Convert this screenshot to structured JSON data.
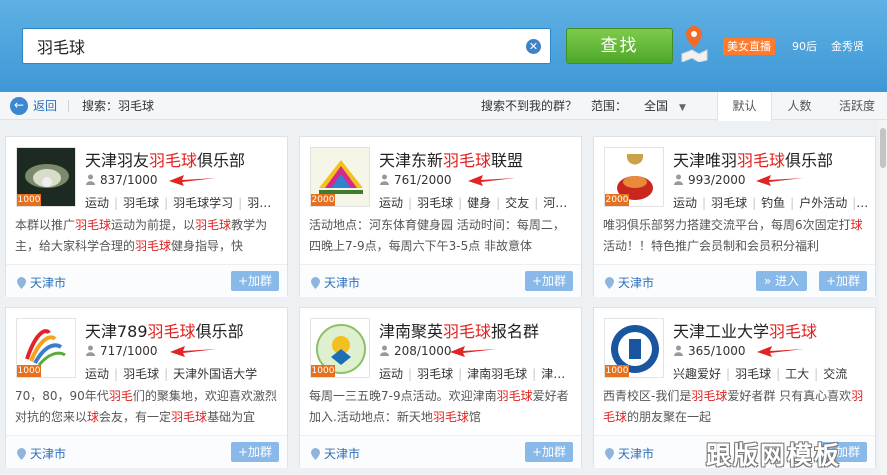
{
  "search": {
    "value": "羽毛球",
    "button_label": "查找"
  },
  "header_links": {
    "live": "美女直播",
    "post90": "90后",
    "beauty": "金秀贤"
  },
  "subbar": {
    "back_label": "返回",
    "search_label": "搜索：羽毛球",
    "not_found": "搜索不到我的群？",
    "range_label": "范围：",
    "range_value": "全国",
    "sort_tabs": [
      "默认",
      "人数",
      "活跃度"
    ]
  },
  "card_actions": {
    "add": "+加群",
    "enter": "» 进入"
  },
  "cards": [
    {
      "title_pre": "天津羽友",
      "title_hl": "羽毛球",
      "title_post": "俱乐部",
      "members": "837/1000",
      "level": "1000",
      "tags": [
        "运动",
        "羽毛球",
        "羽毛球学习",
        "羽…"
      ],
      "desc": [
        {
          "t": "本群以推广"
        },
        {
          "h": "羽毛球"
        },
        {
          "t": "运动为前提，以"
        },
        {
          "h": "羽毛球"
        },
        {
          "t": "教学为主，给大家科学合理的"
        },
        {
          "h": "羽毛球"
        },
        {
          "t": "健身指导，快"
        }
      ],
      "location": "天津市"
    },
    {
      "title_pre": "天津东新",
      "title_hl": "羽毛球",
      "title_post": "联盟",
      "members": "761/2000",
      "level": "2000",
      "tags": [
        "运动",
        "羽毛球",
        "健身",
        "交友",
        "河…"
      ],
      "desc": [
        {
          "t": "活动地点：河东体育健身园 活动时间：每周二，四晚上7-9点，每周六下午3-5点 非故意体"
        }
      ],
      "location": "天津市"
    },
    {
      "title_pre": "天津唯羽",
      "title_hl": "羽毛球",
      "title_post": "俱乐部",
      "members": "993/2000",
      "level": "2000",
      "tags": [
        "运动",
        "羽毛球",
        "钓鱼",
        "户外活动",
        "…"
      ],
      "desc": [
        {
          "t": "唯羽俱乐部努力搭建交流平台，每周6次固定打"
        },
        {
          "h": "球"
        },
        {
          "t": "活动！！特色推广会员制和会员积分福利"
        }
      ],
      "location": "天津市"
    },
    {
      "title_pre": "天津789",
      "title_hl": "羽毛球",
      "title_post": "俱乐部",
      "members": "717/1000",
      "level": "1000",
      "tags": [
        "运动",
        "羽毛球",
        "天津外国语大学"
      ],
      "desc": [
        {
          "t": "70，80，90年代"
        },
        {
          "h": "羽毛"
        },
        {
          "t": "们的聚集地，欢迎喜欢激烈对抗的您来以"
        },
        {
          "h": "球"
        },
        {
          "t": "会友，有一定"
        },
        {
          "h": "羽毛球"
        },
        {
          "t": "基础为宜"
        }
      ],
      "location": "天津市"
    },
    {
      "title_pre": "津南聚英",
      "title_hl": "羽毛球",
      "title_post": "报名群",
      "members": "208/1000",
      "level": "1000",
      "tags": [
        "运动",
        "羽毛球",
        "津南羽毛球",
        "津…"
      ],
      "desc": [
        {
          "t": "每周一三五晚7-9点活动。欢迎津南"
        },
        {
          "h": "羽毛球"
        },
        {
          "t": "爱好者加入.活动地点：新天地"
        },
        {
          "h": "羽毛球"
        },
        {
          "t": "馆"
        }
      ],
      "location": "天津市"
    },
    {
      "title_pre": "天津工业大学",
      "title_hl": "羽毛球",
      "title_post": "",
      "members": "365/1000",
      "level": "1000",
      "tags": [
        "兴趣爱好",
        "羽毛球",
        "工大",
        "交流"
      ],
      "desc": [
        {
          "t": "西青校区-我们是"
        },
        {
          "h": "羽毛球"
        },
        {
          "t": "爱好者群 只有真心喜欢"
        },
        {
          "h": "羽毛球"
        },
        {
          "t": "的朋友聚在一起"
        }
      ],
      "location": "天津市"
    }
  ],
  "watermark": "跟版网模板"
}
